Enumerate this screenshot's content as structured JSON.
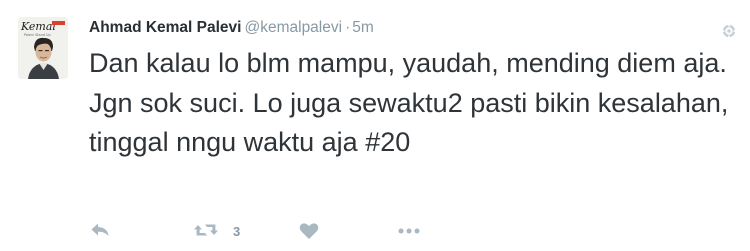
{
  "tweet": {
    "author_name": "Ahmad Kemal Palevi",
    "handle": "@kemalpalevi",
    "separator": "·",
    "timestamp": "5m",
    "text": "Dan kalau lo blm mampu, yaudah, mending diem aja. Jgn sok suci. Lo juga sewaktu2 pasti bikin kesalahan, tinggal nngu waktu aja #20",
    "retweet_count": "3"
  },
  "avatar": {
    "logo_text": "Kemal",
    "logo_subtext": "Palevi Stand Up"
  },
  "icons": {
    "settings": "gear-icon",
    "reply": "reply-icon",
    "retweet": "retweet-icon",
    "like": "heart-icon",
    "more": "more-icon"
  },
  "colors": {
    "name": "#292f33",
    "meta": "#8899a6",
    "text": "#2f3438",
    "icon": "#aab8c2"
  }
}
